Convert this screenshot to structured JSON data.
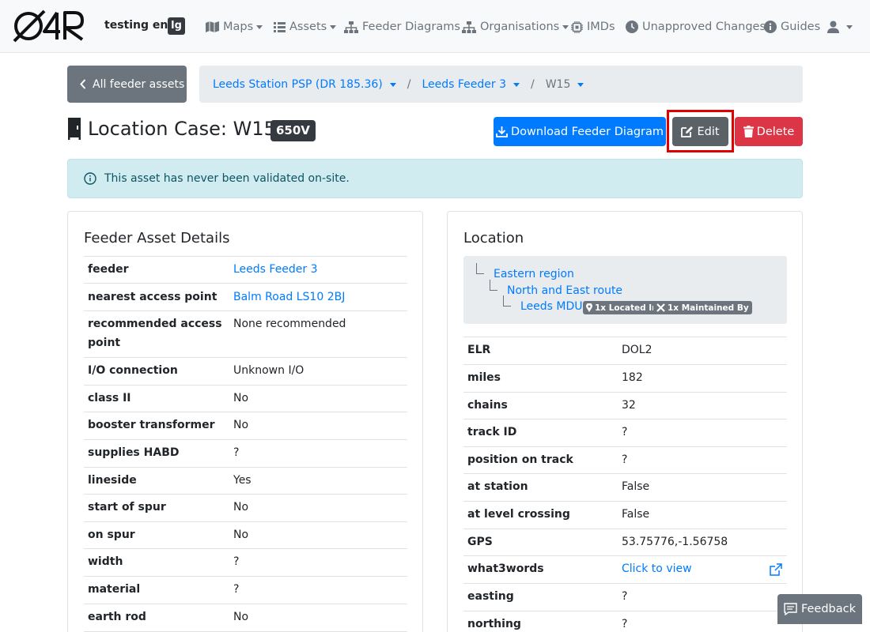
{
  "navbar": {
    "env_name": "testing env",
    "env_badge": "lg",
    "items": [
      {
        "label": "Maps",
        "icon": "map-icon",
        "dropdown": true
      },
      {
        "label": "Assets",
        "icon": "list-icon",
        "dropdown": true
      },
      {
        "label": "Feeder Diagrams",
        "icon": "sitemap-icon",
        "dropdown": false
      },
      {
        "label": "Organisations",
        "icon": "sitemap-icon",
        "dropdown": true
      },
      {
        "label": "IMDs",
        "icon": "chip-icon",
        "dropdown": false
      },
      {
        "label": "Unapproved Changes",
        "icon": "clock-icon",
        "dropdown": false
      },
      {
        "label": "Guides",
        "icon": "info-icon",
        "dropdown": false
      }
    ],
    "user_icon": "user-icon"
  },
  "breadcrumb": {
    "back_label": "All feeder assets",
    "station": "Leeds Station PSP (DR 185.36)",
    "feeder": "Leeds Feeder 3",
    "current": "W15",
    "separator": "/"
  },
  "header": {
    "title": "Location Case: W15",
    "voltage": "650V",
    "download_label": "Download Feeder Diagram",
    "edit_label": "Edit",
    "delete_label": "Delete"
  },
  "alert": {
    "text": "This asset has never been validated on-site."
  },
  "feeder_details": {
    "title": "Feeder Asset Details",
    "rows": [
      {
        "key": "feeder",
        "value": "Leeds Feeder 3"
      },
      {
        "key": "nearest access point",
        "value": "Balm Road LS10 2BJ"
      },
      {
        "key": "recommended access point",
        "value": "None recommended"
      },
      {
        "key": "I/O connection",
        "value": "Unknown I/O"
      },
      {
        "key": "class II",
        "value": "No"
      },
      {
        "key": "booster transformer",
        "value": "No"
      },
      {
        "key": "supplies HABD",
        "value": "?"
      },
      {
        "key": "lineside",
        "value": "Yes"
      },
      {
        "key": "start of spur",
        "value": "No"
      },
      {
        "key": "on spur",
        "value": "No"
      },
      {
        "key": "width",
        "value": "?"
      },
      {
        "key": "material",
        "value": "?"
      },
      {
        "key": "earth rod",
        "value": "No"
      }
    ]
  },
  "location": {
    "title": "Location",
    "tree": {
      "region": "Eastern region",
      "route": "North and East route",
      "mdu": "Leeds MDU",
      "tag_located": "1x Located In",
      "tag_maintained": "1x Maintained By"
    },
    "rows": [
      {
        "key": "ELR",
        "value": "DOL2"
      },
      {
        "key": "miles",
        "value": "182"
      },
      {
        "key": "chains",
        "value": "32"
      },
      {
        "key": "track ID",
        "value": "?"
      },
      {
        "key": "position on track",
        "value": "?"
      },
      {
        "key": "at station",
        "value": "False"
      },
      {
        "key": "at level crossing",
        "value": "False"
      },
      {
        "key": "GPS",
        "value": "53.75776,-1.56758"
      },
      {
        "key": "what3words",
        "value": "Click to view"
      },
      {
        "key": "easting",
        "value": "?"
      },
      {
        "key": "northing",
        "value": "?"
      }
    ]
  },
  "feedback": {
    "label": "Feedback"
  },
  "colors": {
    "primary": "#007bff",
    "secondary": "#6c757d",
    "danger": "#dc3545",
    "info_bg": "#d1ecf1",
    "highlight": "#e00000"
  }
}
